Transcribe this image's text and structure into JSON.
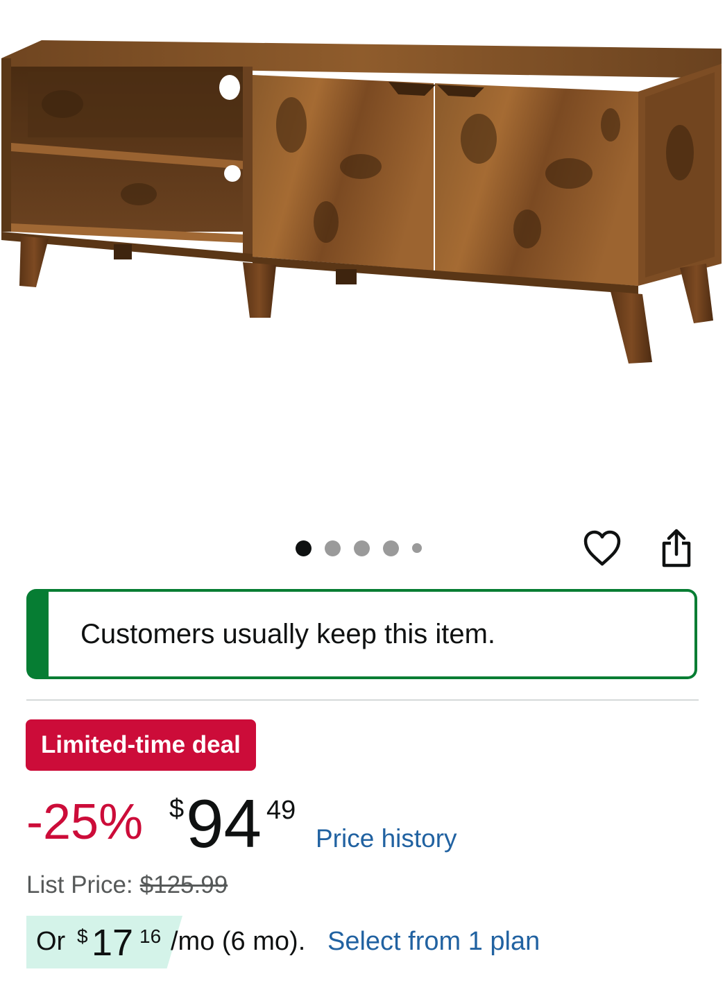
{
  "gallery": {
    "image_alt": "Rustic brown wooden TV stand with open shelves and two cabinet doors",
    "dot_count": 5,
    "active_dot": 1
  },
  "actions": {
    "wishlist_icon": "heart-icon",
    "share_icon": "share-icon"
  },
  "banner": {
    "text": "Customers usually keep this item.",
    "accent_color": "#067d33"
  },
  "deal": {
    "badge_label": "Limited-time deal",
    "badge_color": "#cc0c39"
  },
  "price": {
    "discount": "-25%",
    "currency_symbol": "$",
    "whole": "94",
    "fraction": "49",
    "history_link": "Price history"
  },
  "list_price": {
    "label": "List Price:",
    "value": "$125.99"
  },
  "installment": {
    "prefix": "Or",
    "currency_symbol": "$",
    "whole": "17",
    "fraction": "16",
    "term": "/mo (6 mo).",
    "link": "Select from 1 plan"
  },
  "colors": {
    "link": "#2162a1",
    "deal_red": "#cc0c39",
    "install_highlight": "#d4f3e9"
  }
}
